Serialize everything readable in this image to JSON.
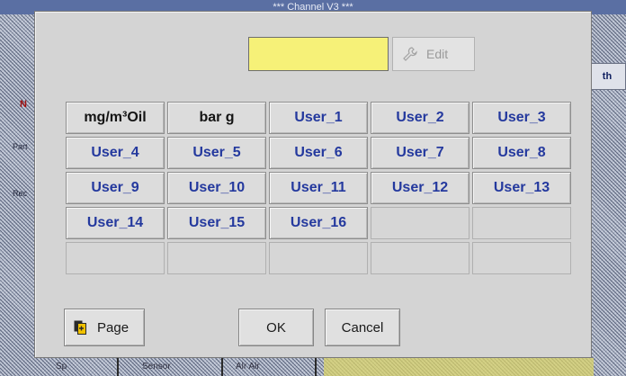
{
  "window_title": "*** Channel V3 ***",
  "background": {
    "left_fragments": [
      "N",
      "Part",
      "Rec"
    ],
    "right_button": "th",
    "bottom_labels": [
      "Sp",
      "Sensor",
      "Alr Alr"
    ]
  },
  "dialog": {
    "input_value": "",
    "edit_label": "Edit",
    "unit_rows": [
      [
        {
          "label": "mg/m³Oil",
          "kind": "unit"
        },
        {
          "label": "bar g",
          "kind": "unit"
        },
        {
          "label": "User_1",
          "kind": "user"
        },
        {
          "label": "User_2",
          "kind": "user"
        },
        {
          "label": "User_3",
          "kind": "user"
        }
      ],
      [
        {
          "label": "User_4",
          "kind": "user"
        },
        {
          "label": "User_5",
          "kind": "user"
        },
        {
          "label": "User_6",
          "kind": "user"
        },
        {
          "label": "User_7",
          "kind": "user"
        },
        {
          "label": "User_8",
          "kind": "user"
        }
      ],
      [
        {
          "label": "User_9",
          "kind": "user"
        },
        {
          "label": "User_10",
          "kind": "user"
        },
        {
          "label": "User_11",
          "kind": "user"
        },
        {
          "label": "User_12",
          "kind": "user"
        },
        {
          "label": "User_13",
          "kind": "user"
        }
      ],
      [
        {
          "label": "User_14",
          "kind": "user"
        },
        {
          "label": "User_15",
          "kind": "user"
        },
        {
          "label": "User_16",
          "kind": "user"
        },
        {
          "label": "",
          "kind": "empty"
        },
        {
          "label": "",
          "kind": "empty"
        }
      ],
      [
        {
          "label": "",
          "kind": "empty"
        },
        {
          "label": "",
          "kind": "empty"
        },
        {
          "label": "",
          "kind": "empty"
        },
        {
          "label": "",
          "kind": "empty"
        },
        {
          "label": "",
          "kind": "empty"
        }
      ]
    ],
    "page_label": "Page",
    "ok_label": "OK",
    "cancel_label": "Cancel"
  },
  "colors": {
    "user_text": "#24399e",
    "unit_text": "#141414",
    "input_bg": "#f6f178",
    "dialog_bg": "#d4d4d4"
  },
  "icons": {
    "edit": "wrench-icon",
    "page": "page-switch-icon"
  }
}
